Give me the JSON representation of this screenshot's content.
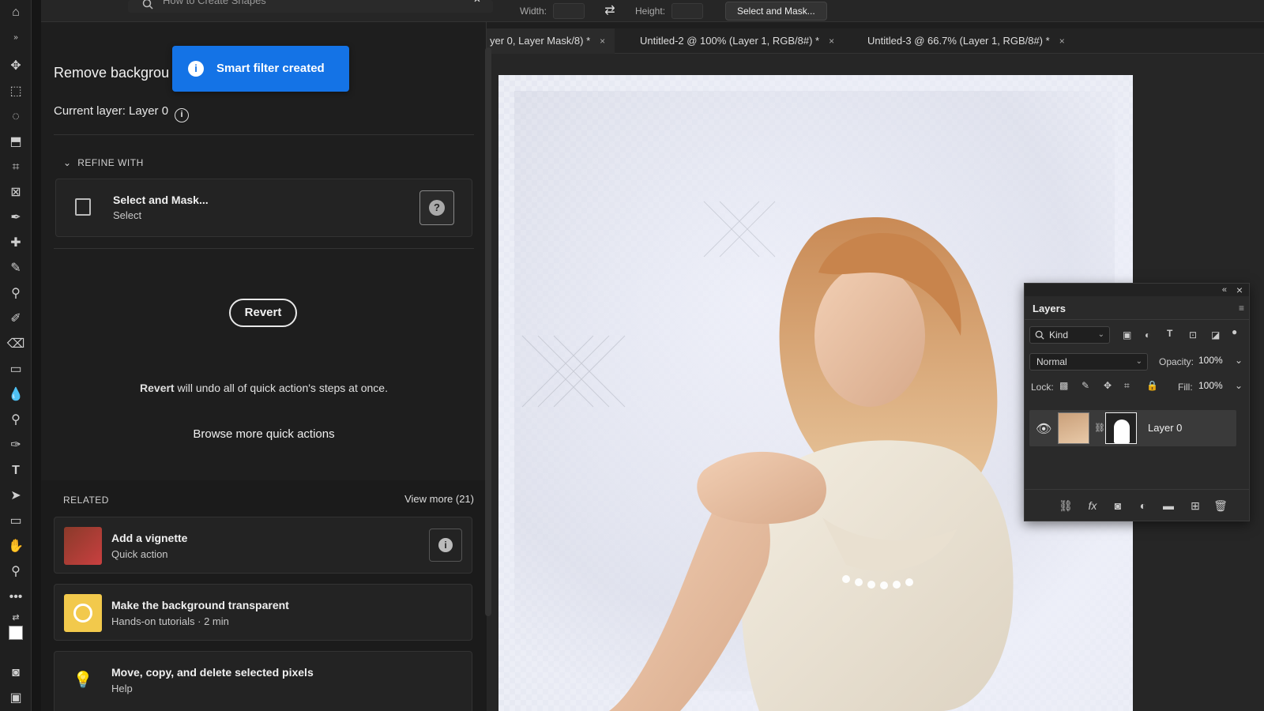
{
  "topbar": {
    "search_value": "How to Create Shapes",
    "width_label": "Width:",
    "height_label": "Height:",
    "select_mask_button": "Select and Mask..."
  },
  "tabs": [
    {
      "label": "yer 0, Layer Mask/8) *",
      "close": "×"
    },
    {
      "label": "Untitled-2 @ 100% (Layer 1, RGB/8#) *",
      "close": "×"
    },
    {
      "label": "Untitled-3 @ 66.7% (Layer 1, RGB/8#) *",
      "close": "×"
    }
  ],
  "panel": {
    "title": "Remove backgrou",
    "toast": "Smart filter created",
    "current_layer": "Current layer: Layer 0",
    "refine_heading": "REFINE WITH",
    "refine_card": {
      "title": "Select and Mask...",
      "subtitle": "Select"
    },
    "revert_button": "Revert",
    "revert_bold": "Revert",
    "revert_note": " will undo all of quick action's steps at once.",
    "browse_link": "Browse more quick actions",
    "related_heading": "RELATED",
    "view_more": "View more (21)",
    "related": [
      {
        "title": "Add a vignette",
        "subtitle": "Quick action",
        "thumb_color": "#c94040"
      },
      {
        "title": "Make the background transparent",
        "subtitle": "Hands-on tutorials",
        "duration": "2 min",
        "thumb_color": "#f2c94c"
      },
      {
        "title": "Move, copy, and delete selected pixels",
        "subtitle": "Help"
      }
    ]
  },
  "layers_panel": {
    "tab": "Layers",
    "filter_kind": "Kind",
    "blend_mode": "Normal",
    "opacity_label": "Opacity:",
    "opacity_value": "100%",
    "lock_label": "Lock:",
    "fill_label": "Fill:",
    "fill_value": "100%",
    "layers": [
      {
        "name": "Layer 0",
        "visible": true
      }
    ]
  },
  "colors": {
    "accent": "#1473e6",
    "panel_bg": "#1e1e1e"
  }
}
